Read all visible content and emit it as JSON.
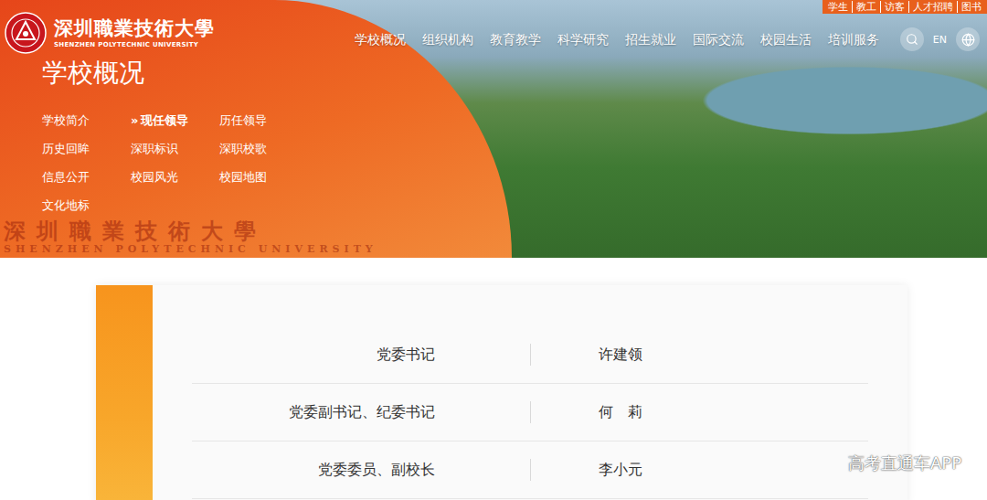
{
  "header": {
    "logo": {
      "name_zh": "深圳職業技術大學",
      "name_en": "SHENZHEN POLYTECHNIC UNIVERSITY"
    },
    "utility_links": [
      "学生",
      "教工",
      "访客",
      "人才招聘",
      "图书"
    ],
    "nav": [
      {
        "label": "学校概况",
        "selected": false
      },
      {
        "label": "组织机构",
        "selected": false
      },
      {
        "label": "教育教学",
        "selected": false
      },
      {
        "label": "科学研究",
        "selected": false
      },
      {
        "label": "招生就业",
        "selected": false
      },
      {
        "label": "国际交流",
        "selected": false
      },
      {
        "label": "校园生活",
        "selected": false
      },
      {
        "label": "培训服务",
        "selected": false
      }
    ],
    "language": "EN"
  },
  "section": {
    "title": "学校概况",
    "marker": "»",
    "items": [
      {
        "label": "学校简介",
        "selected": false
      },
      {
        "label": "现任领导",
        "selected": true
      },
      {
        "label": "历任领导",
        "selected": false
      },
      {
        "label": "历史回眸",
        "selected": false
      },
      {
        "label": "深职标识",
        "selected": false
      },
      {
        "label": "深职校歌",
        "selected": false
      },
      {
        "label": "信息公开",
        "selected": false
      },
      {
        "label": "校园风光",
        "selected": false
      },
      {
        "label": "校园地图",
        "selected": false
      },
      {
        "label": "文化地标",
        "selected": false
      }
    ]
  },
  "banner_watermark": {
    "zh": "深圳職業技術大學",
    "en": "SHENZHEN POLYTECHNIC UNIVERSITY"
  },
  "leaders": [
    {
      "role": "党委书记",
      "name": "许建领"
    },
    {
      "role": "党委副书记、纪委书记",
      "name": "何　莉"
    },
    {
      "role": "党委委员、副校长",
      "name": "李小元"
    }
  ],
  "watermark": "高考直通车APP"
}
